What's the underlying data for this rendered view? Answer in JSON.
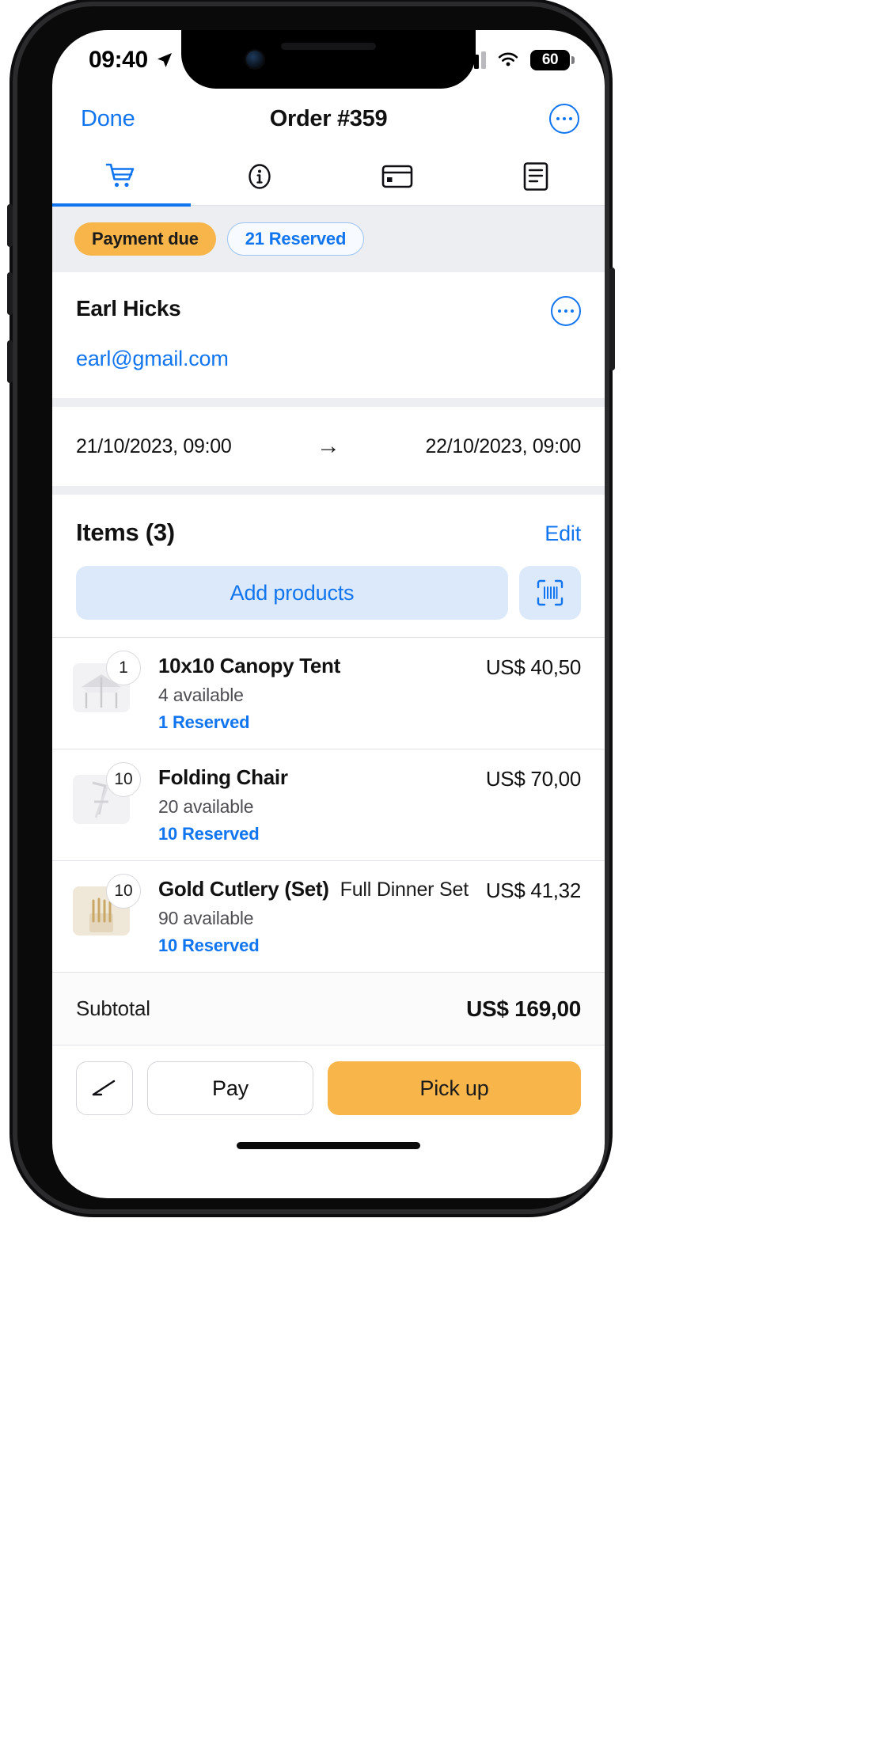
{
  "status_bar": {
    "time": "09:40",
    "location_icon": "location-arrow-icon",
    "signal_icon": "cellular-signal-icon",
    "wifi_icon": "wifi-icon",
    "battery_level": "60"
  },
  "nav": {
    "back_label": "Done",
    "title": "Order #359",
    "more_icon": "more-options-icon"
  },
  "tabs": [
    {
      "icon": "cart-icon",
      "active": true
    },
    {
      "icon": "info-circle-icon",
      "active": false
    },
    {
      "icon": "credit-card-icon",
      "active": false
    },
    {
      "icon": "document-icon",
      "active": false
    }
  ],
  "status_pills": [
    {
      "label": "Payment due",
      "style": "warn"
    },
    {
      "label": "21 Reserved",
      "style": "outline"
    }
  ],
  "customer": {
    "name": "Earl Hicks",
    "email": "earl@gmail.com",
    "more_icon": "more-options-icon"
  },
  "dates": {
    "start": "21/10/2023, 09:00",
    "arrow": "→",
    "end": "22/10/2023, 09:00"
  },
  "items_section": {
    "title": "Items  (3)",
    "edit_label": "Edit",
    "add_products_label": "Add products",
    "scan_icon": "barcode-scan-icon"
  },
  "items": [
    {
      "qty": "1",
      "name": "10x10 Canopy Tent",
      "variant": "",
      "availability": "4 available",
      "reserved": "1 Reserved",
      "price": "US$ 40,50",
      "thumb": "canopy-tent-thumbnail"
    },
    {
      "qty": "10",
      "name": "Folding Chair",
      "variant": "",
      "availability": "20 available",
      "reserved": "10 Reserved",
      "price": "US$ 70,00",
      "thumb": "folding-chair-thumbnail"
    },
    {
      "qty": "10",
      "name": "Gold Cutlery (Set)",
      "variant": "Full Dinner Set",
      "availability": "90 available",
      "reserved": "10 Reserved",
      "price": "US$ 41,32",
      "thumb": "gold-cutlery-thumbnail"
    }
  ],
  "subtotal": {
    "label": "Subtotal",
    "value": "US$ 169,00"
  },
  "actions": {
    "edit_icon": "signature-pen-icon",
    "pay_label": "Pay",
    "primary_label": "Pick up"
  },
  "colors": {
    "accent_blue": "#1175f0",
    "warn_orange": "#f7b54a",
    "pill_bg": "#eceef1"
  }
}
